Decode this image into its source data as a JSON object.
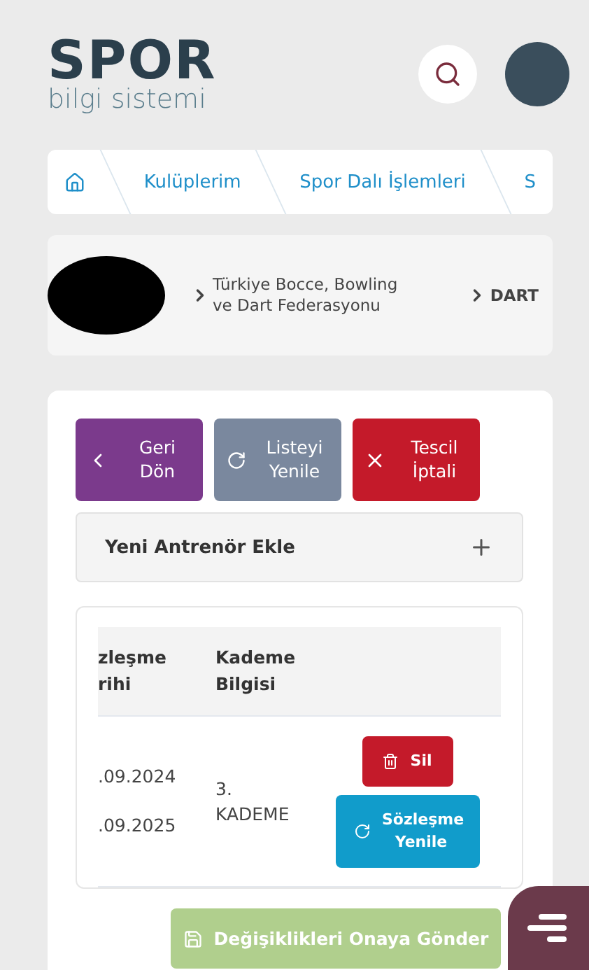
{
  "header": {
    "logo_title": "SPOR",
    "logo_subtitle": "bilgi sistemi"
  },
  "breadcrumb": [
    {
      "label": "Kulüplerim"
    },
    {
      "label": "Spor Dalı İşlemleri"
    },
    {
      "label": "S"
    }
  ],
  "path": [
    {
      "label": "Türkiye Bocce, Bowling ve Dart Federasyonu"
    },
    {
      "label": "DART"
    }
  ],
  "actions": [
    {
      "kind": "back",
      "label": "Geri Dön",
      "color": "#7b3a8c"
    },
    {
      "kind": "refresh",
      "label": "Listeyi Yenile",
      "color": "#7a889e"
    },
    {
      "kind": "cancel",
      "label": "Tescil İptali",
      "color": "#c41a2a"
    }
  ],
  "accordion": {
    "title": "Yeni Antrenör Ekle",
    "expanded": false
  },
  "table": {
    "columns": [
      "zleşme\nrihi",
      "Kademe\nBilgisi"
    ],
    "rows": [
      {
        "cells": [
          ".09.2024\n\n.09.2025",
          "3.\nKADEME"
        ],
        "buttons": [
          {
            "kind": "delete",
            "label": "Sil"
          },
          {
            "kind": "renew",
            "label": "Sözleşme Yenile"
          }
        ]
      }
    ]
  },
  "submit": {
    "label": "Değişiklikleri Onaya Gönder",
    "disabled": true
  }
}
